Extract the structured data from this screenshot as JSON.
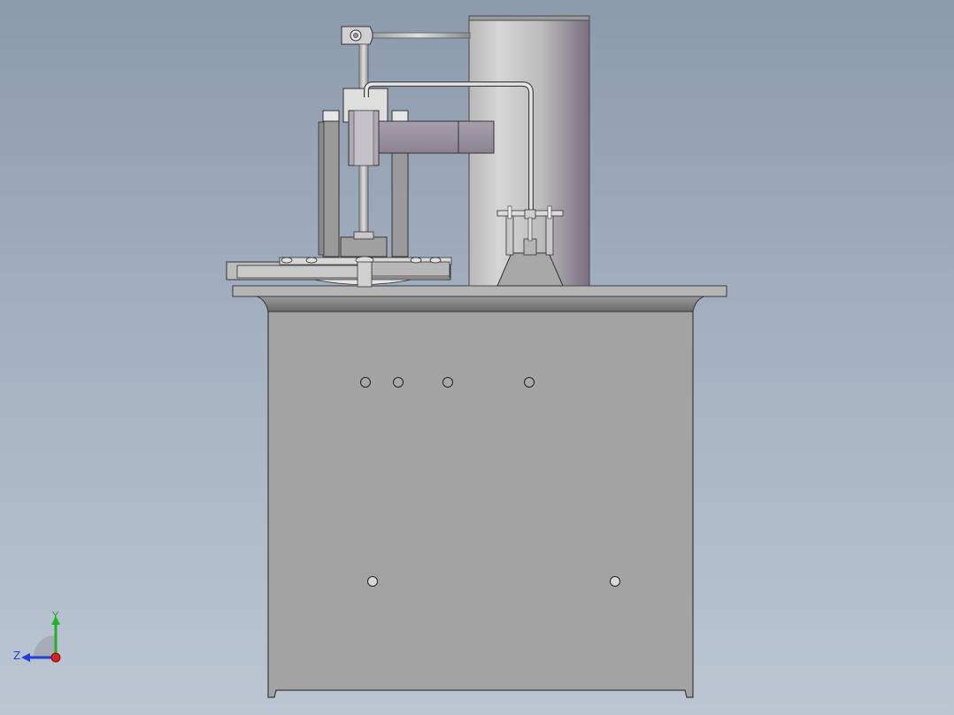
{
  "viewport": {
    "background_top": "#8c9aad",
    "background_bottom": "#bcc6d3"
  },
  "triad": {
    "y_label": "Y",
    "z_label": "Z",
    "y_color": "#1fb41f",
    "z_color": "#1f3fd6",
    "x_color": "#d61f1f"
  },
  "model": {
    "cabinet_color": "#a3a3a3",
    "cylinder_color": "#c4c4c4",
    "edge_color": "#3a3a3a"
  }
}
